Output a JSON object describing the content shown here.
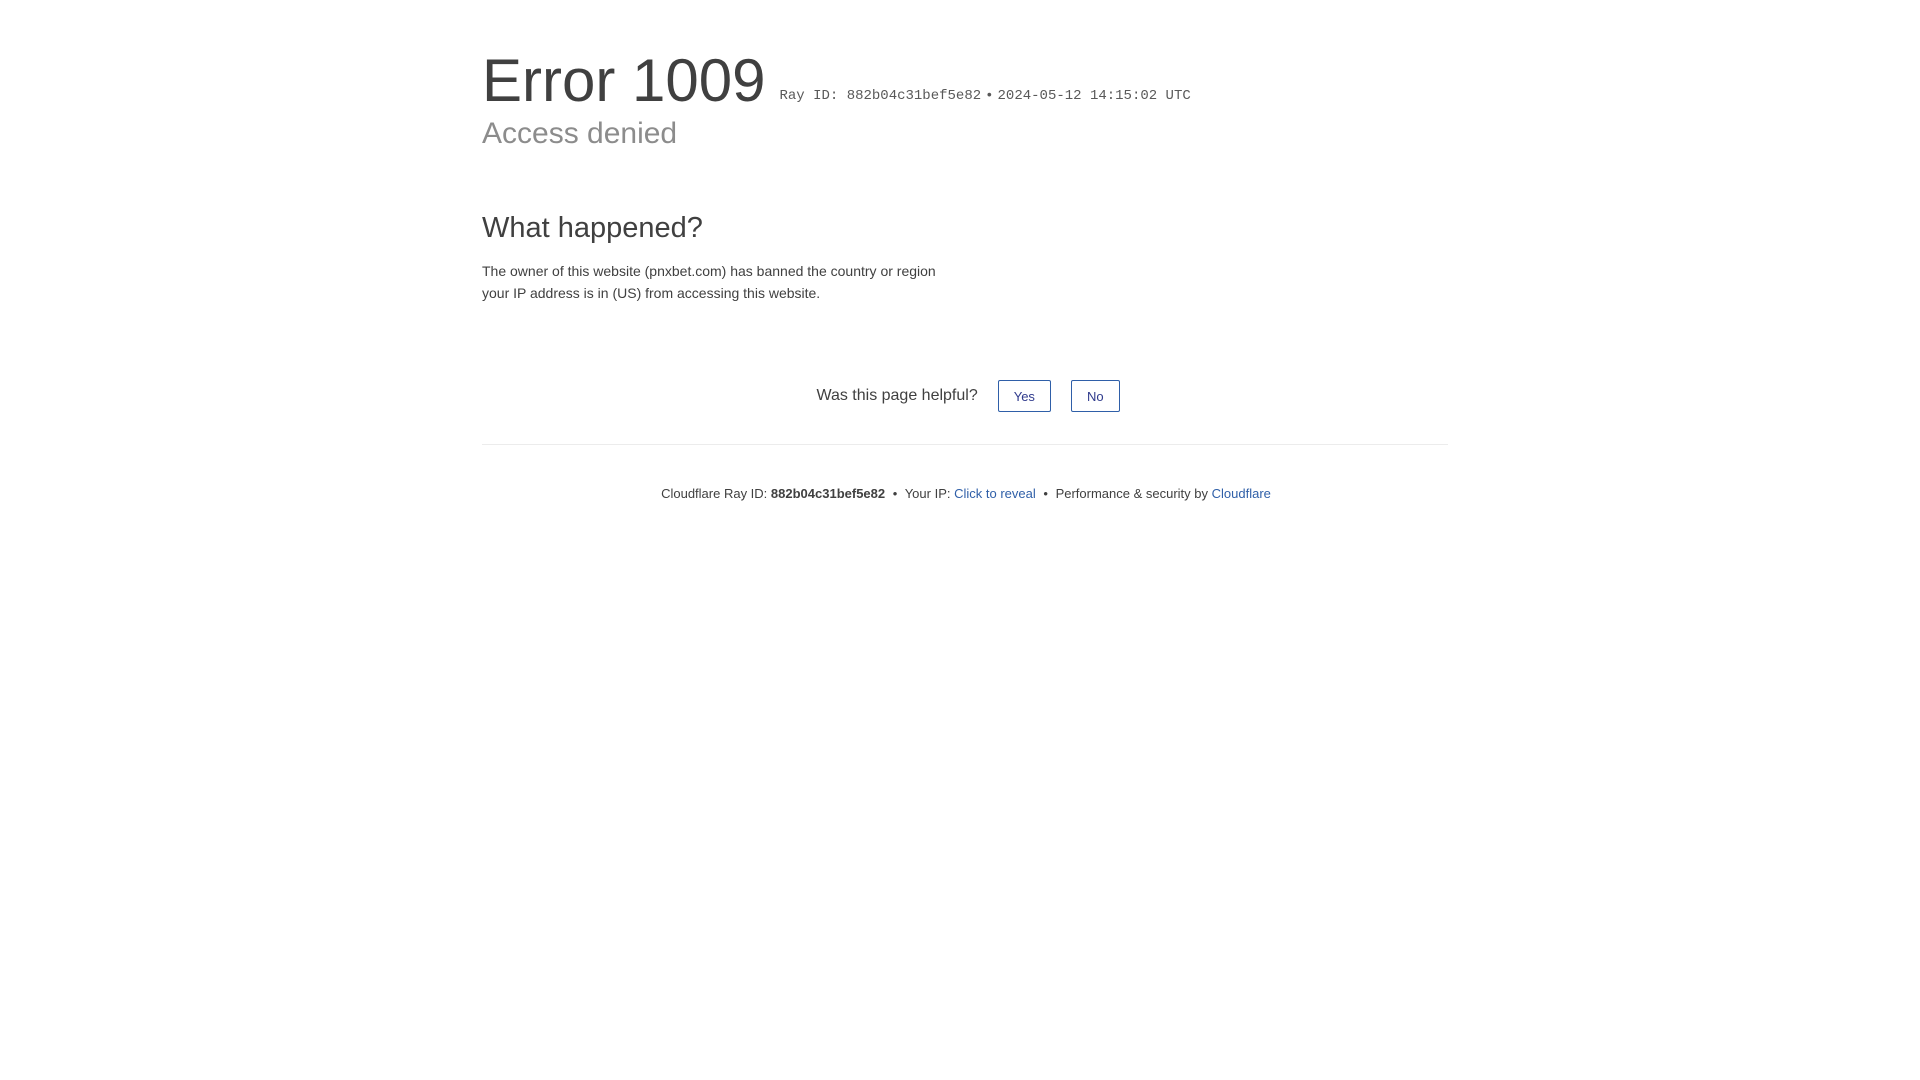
{
  "header": {
    "error_title": "Error 1009",
    "ray_label": "Ray ID: 882b04c31bef5e82",
    "separator": "•",
    "timestamp": "2024-05-12 14:15:02 UTC",
    "subtitle": "Access denied"
  },
  "what_happened": {
    "title": "What happened?",
    "text": "The owner of this website (pnxbet.com) has banned the country or region your IP address is in (US) from accessing this website."
  },
  "feedback": {
    "question": "Was this page helpful?",
    "yes_label": "Yes",
    "no_label": "No"
  },
  "footer": {
    "ray_prefix": "Cloudflare Ray ID:",
    "ray_id": "882b04c31bef5e82",
    "separator": "•",
    "ip_prefix": "Your IP:",
    "ip_link": "Click to reveal",
    "perf_text": "Performance & security by",
    "cloudflare_link": "Cloudflare"
  },
  "colors": {
    "link": "#2f5fa8",
    "text": "#404040",
    "muted": "#8c8c8c"
  }
}
